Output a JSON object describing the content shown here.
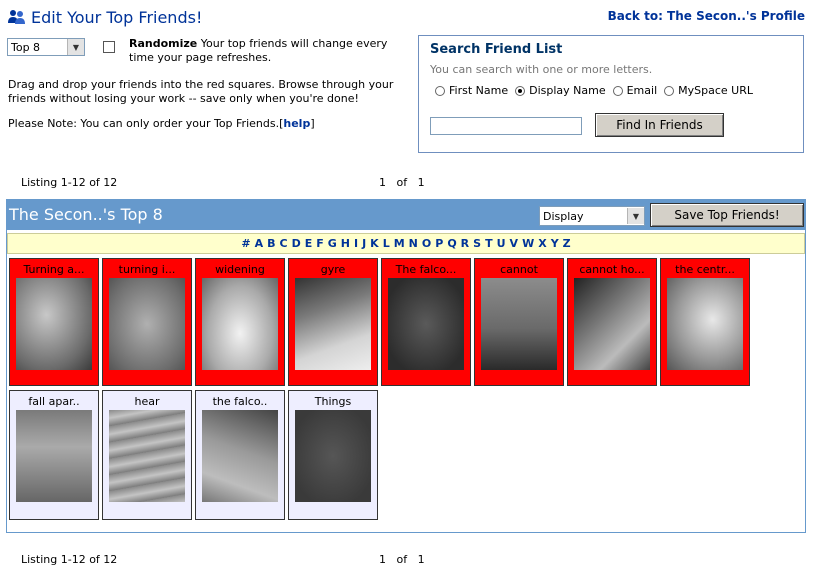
{
  "header": {
    "title": "Edit Your Top Friends!",
    "back_link": "Back to: The Secon..'s Profile",
    "icon": "friends-icon"
  },
  "controls": {
    "top_select_value": "Top 8",
    "randomize_label": "Randomize",
    "randomize_desc": "Your top friends will change every time your page refreshes.",
    "instructions": "Drag and drop your friends into the red squares. Browse through your friends without losing your work -- save only when you're done!",
    "note": "Please Note: You can only order your Top Friends.[",
    "help_link": "help",
    "note_end": "]"
  },
  "search": {
    "title": "Search Friend List",
    "hint": "You can search with one or more letters.",
    "options": [
      "First Name",
      "Display Name",
      "Email",
      "MySpace URL"
    ],
    "selected": "Display Name",
    "input_value": "",
    "button": "Find In Friends"
  },
  "listing": {
    "text": "Listing 1-12 of 12",
    "page": "1",
    "of": "of",
    "total": "1"
  },
  "panel": {
    "title": "The Secon..'s Top 8",
    "display_select_value": "Display",
    "save_button": "Save Top Friends!"
  },
  "alphabet": [
    "#",
    "A",
    "B",
    "C",
    "D",
    "E",
    "F",
    "G",
    "H",
    "I",
    "J",
    "K",
    "L",
    "M",
    "N",
    "O",
    "P",
    "Q",
    "R",
    "S",
    "T",
    "U",
    "V",
    "W",
    "X",
    "Y",
    "Z"
  ],
  "top_friends": [
    {
      "name": "Turning a..."
    },
    {
      "name": "turning i..."
    },
    {
      "name": "widening"
    },
    {
      "name": "gyre"
    },
    {
      "name": "The falco..."
    },
    {
      "name": "cannot"
    },
    {
      "name": "cannot ho..."
    },
    {
      "name": "the centr..."
    }
  ],
  "other_friends": [
    {
      "name": "fall apar.."
    },
    {
      "name": "hear"
    },
    {
      "name": "the falco.."
    },
    {
      "name": "Things"
    }
  ],
  "colors": {
    "brand": "#003399",
    "panel_header": "#6699cc",
    "top_slot": "#ff0000",
    "alpha_bar": "#ffffcc"
  }
}
